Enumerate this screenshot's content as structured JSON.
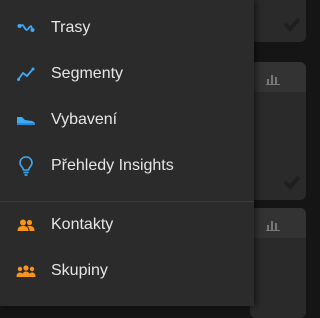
{
  "menu": {
    "activity_items": [
      {
        "label": "Trasy",
        "icon": "route-icon"
      },
      {
        "label": "Segmenty",
        "icon": "segment-icon"
      },
      {
        "label": "Vybavení",
        "icon": "shoe-icon"
      },
      {
        "label": "Přehledy Insights",
        "icon": "lightbulb-icon"
      }
    ],
    "social_items": [
      {
        "label": "Kontakty",
        "icon": "contacts-icon"
      },
      {
        "label": "Skupiny",
        "icon": "groups-icon"
      }
    ]
  },
  "colors": {
    "activity_accent": "#3fa9f5",
    "social_accent": "#f7941d",
    "drawer_bg": "#2b2b2b",
    "text": "#e6e6e6"
  }
}
